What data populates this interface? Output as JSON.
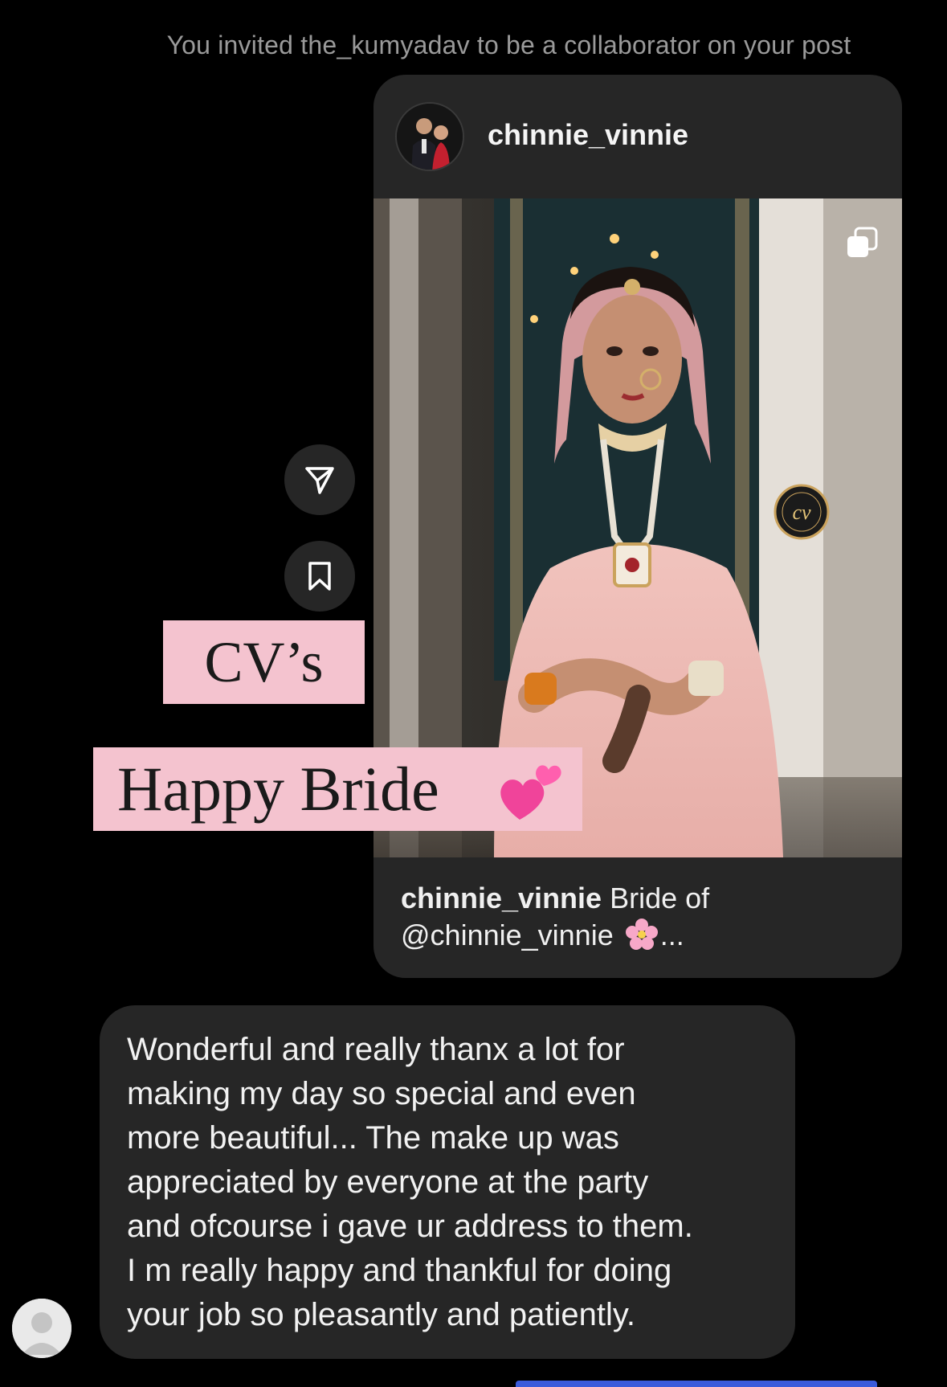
{
  "system_message": "You invited the_kumyadav to be a collaborator on your post",
  "post": {
    "username": "chinnie_vinnie",
    "avatar_icon": "profile-couple-avatar-icon",
    "carousel_icon": "multiple-images-icon",
    "watermark_icon": "cv-logo-watermark-icon",
    "caption_user": "chinnie_vinnie",
    "caption_text_1": " Bride of",
    "caption_mention": "@chinnie_vinnie",
    "caption_emoji": "cherry-blossom-icon",
    "caption_ellipsis": "..."
  },
  "actions": {
    "share_icon": "paper-plane-icon",
    "save_icon": "bookmark-icon"
  },
  "stickers": {
    "line1": "CV’s",
    "line2": "Happy Bride",
    "emoji": "two-hearts-icon",
    "color": "#f4c3cf"
  },
  "message": {
    "text": "Wonderful and really thanx a lot for\nmaking my day so special and even\nmore beautiful... The make up was\nappreciated by everyone at the party\nand ofcourse i gave ur address to them.\nI m really happy and thankful for doing\nyour job so pleasantly and patiently.",
    "sender_avatar_icon": "default-user-avatar-icon"
  },
  "colors": {
    "background": "#000000",
    "bubble": "#262626",
    "system_text": "#9a9a9a",
    "accent_bar": "#3b5bdb"
  }
}
